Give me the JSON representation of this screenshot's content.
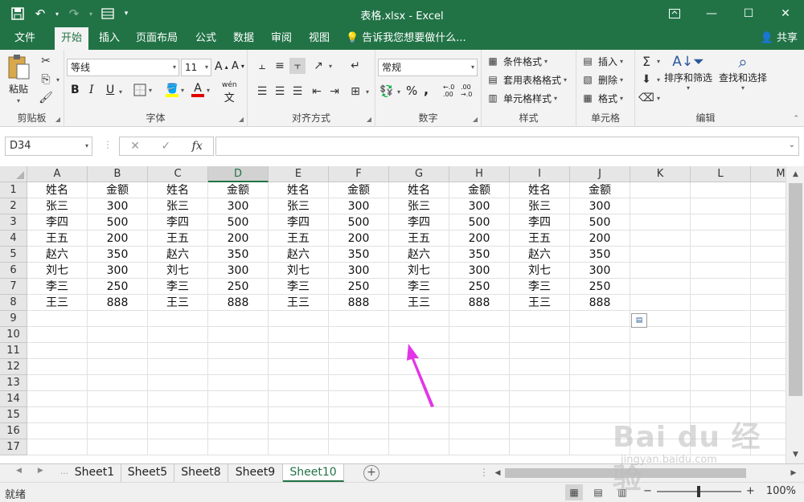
{
  "window": {
    "title": "表格.xlsx - Excel"
  },
  "ribbon_tabs": [
    "文件",
    "开始",
    "插入",
    "页面布局",
    "公式",
    "数据",
    "审阅",
    "视图"
  ],
  "active_tab": "开始",
  "tell_me": "告诉我您想要做什么...",
  "share": "共享",
  "ribbon": {
    "clipboard": {
      "paste": "粘贴",
      "label": "剪贴板"
    },
    "font": {
      "name": "等线",
      "size": "11",
      "label": "字体",
      "bold": "B",
      "italic": "I",
      "underline": "U",
      "phonetic": "wén"
    },
    "alignment": {
      "label": "对齐方式"
    },
    "number": {
      "format": "常规",
      "label": "数字",
      "percent": "%",
      "comma": ","
    },
    "styles": {
      "conditional": "条件格式",
      "table": "套用表格格式",
      "cell": "单元格样式",
      "label": "样式"
    },
    "cells": {
      "insert": "插入",
      "delete": "删除",
      "format": "格式",
      "label": "单元格"
    },
    "editing": {
      "sort": "排序和筛选",
      "find": "查找和选择",
      "label": "编辑"
    }
  },
  "formula_bar": {
    "name_box": "D34",
    "fx": "fx",
    "content": ""
  },
  "columns": [
    "A",
    "B",
    "C",
    "D",
    "E",
    "F",
    "G",
    "H",
    "I",
    "J",
    "K",
    "L",
    "M"
  ],
  "selected_column": "D",
  "rows": [
    "1",
    "2",
    "3",
    "4",
    "5",
    "6",
    "7",
    "8",
    "9",
    "10",
    "11",
    "12",
    "13",
    "14",
    "15",
    "16",
    "17"
  ],
  "cells": [
    [
      "姓名",
      "金额",
      "姓名",
      "金额",
      "姓名",
      "金额",
      "姓名",
      "金额",
      "姓名",
      "金额"
    ],
    [
      "张三",
      "300",
      "张三",
      "300",
      "张三",
      "300",
      "张三",
      "300",
      "张三",
      "300"
    ],
    [
      "李四",
      "500",
      "李四",
      "500",
      "李四",
      "500",
      "李四",
      "500",
      "李四",
      "500"
    ],
    [
      "王五",
      "200",
      "王五",
      "200",
      "王五",
      "200",
      "王五",
      "200",
      "王五",
      "200"
    ],
    [
      "赵六",
      "350",
      "赵六",
      "350",
      "赵六",
      "350",
      "赵六",
      "350",
      "赵六",
      "350"
    ],
    [
      "刘七",
      "300",
      "刘七",
      "300",
      "刘七",
      "300",
      "刘七",
      "300",
      "刘七",
      "300"
    ],
    [
      "李三",
      "250",
      "李三",
      "250",
      "李三",
      "250",
      "李三",
      "250",
      "李三",
      "250"
    ],
    [
      "王三",
      "888",
      "王三",
      "888",
      "王三",
      "888",
      "王三",
      "888",
      "王三",
      "888"
    ]
  ],
  "sheets": [
    "Sheet1",
    "Sheet5",
    "Sheet8",
    "Sheet9",
    "Sheet10"
  ],
  "active_sheet": "Sheet10",
  "status": {
    "ready": "就绪",
    "zoom": "100%",
    "zoom_level": 1.0
  },
  "watermark": {
    "main": "Bai du 经验",
    "sub": "jingyan.baidu.com"
  },
  "colors": {
    "excel_green": "#217346",
    "arrow": "#e335e8"
  }
}
